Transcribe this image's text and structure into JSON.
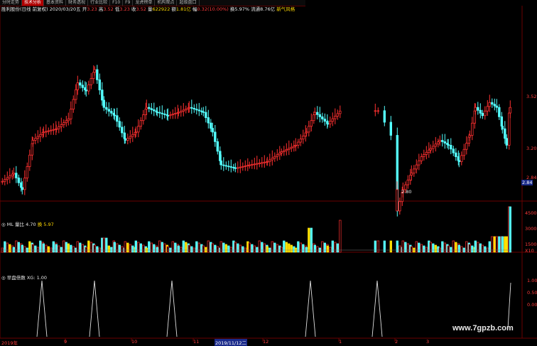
{
  "tabs": [
    "分时走势",
    "技术分析",
    "基本资料",
    "财务透视",
    "行业比较",
    "F10",
    "F9",
    "龙虎榜单",
    "机构观点",
    "超级盘口"
  ],
  "active_tab_index": 1,
  "info1": {
    "name": "胜利股份(日线 前复权)",
    "date": "2020/03/20五",
    "open_l": "开",
    "open_v": "3.23",
    "high_l": "高",
    "high_v": "3.52",
    "low_l": "低",
    "low_v": "3.23",
    "close_l": "收",
    "close_v": "3.52",
    "vol_l": "量",
    "vol_v": "622922",
    "amt_l": "额",
    "amt_v": "1.81亿",
    "chg_l": "幅",
    "chg_v": "0.32(10.00%)",
    "turn_l": "换",
    "turn_v": "5.97%",
    "float_l": "流通",
    "float_v": "8.76亿",
    "tag": "新气风格"
  },
  "info2": {
    "title": "ML 量比",
    "v1": "4.70",
    "l2": "换",
    "v2": "5.97"
  },
  "info3": {
    "title": "早盘倍数 XG:",
    "v1": "1.00"
  },
  "price_labels": [
    "3.52",
    "3.20",
    "2.84",
    "2.84"
  ],
  "low_marker": "2.80",
  "vol_labels": [
    "45000",
    "30000",
    "15000",
    "X10"
  ],
  "ind_labels": [
    "1.00",
    "0.50",
    "0.00"
  ],
  "x_labels": [
    "2019年",
    "9",
    "10",
    "11",
    "2019/11/12二",
    "12",
    "1",
    "2",
    "3"
  ],
  "x_selected_index": 4,
  "watermark": "www.7gpzb.com",
  "colors": {
    "up": "#ff3030",
    "down": "#54ffff",
    "hl": "#ffe000",
    "grid": "#6a0000"
  }
}
